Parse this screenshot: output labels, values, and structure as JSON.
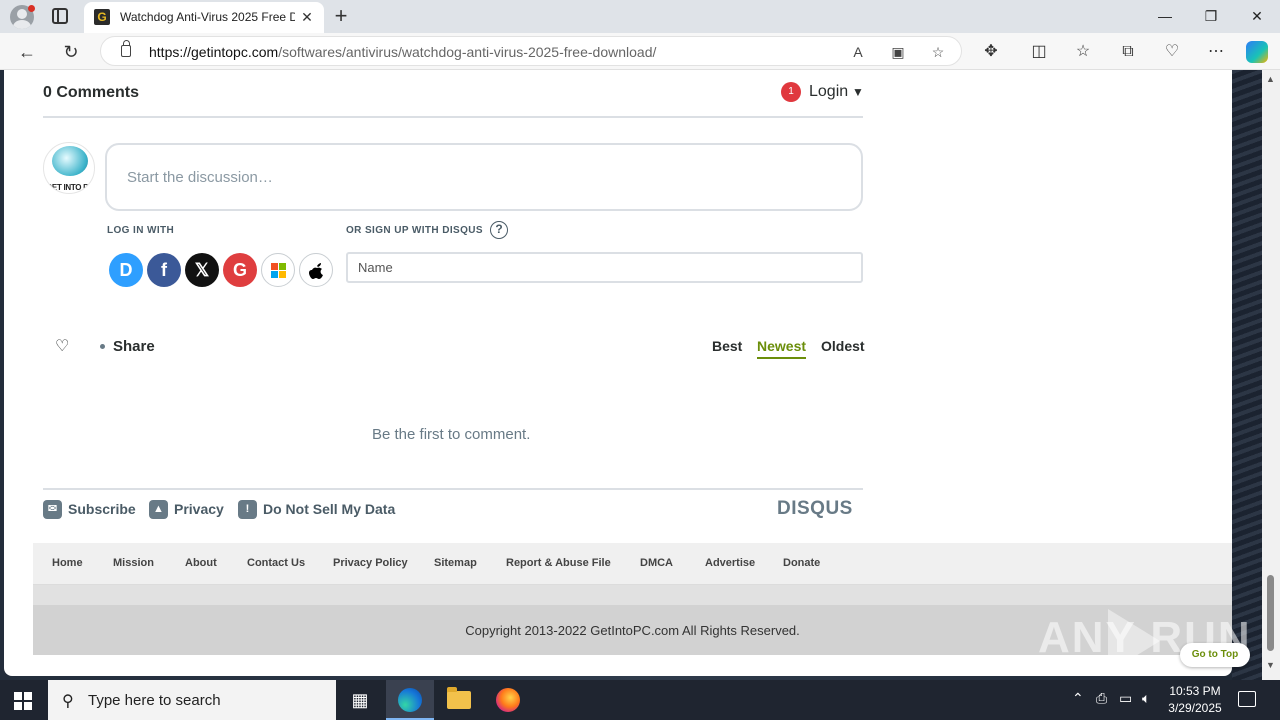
{
  "browser": {
    "tab_title": "Watchdog Anti-Virus 2025 Free D",
    "favicon_letter": "G",
    "url_domain": "https://getintopc.com",
    "url_path": "/softwares/antivirus/watchdog-anti-virus-2025-free-download/"
  },
  "disqus": {
    "comments_count": "0 Comments",
    "notification_count": "1",
    "login_label": "Login",
    "avatar_text": "GET INTO PC",
    "discussion_placeholder": "Start the discussion…",
    "log_in_with": "LOG IN WITH",
    "sign_up_with": "OR SIGN UP WITH DISQUS",
    "help_symbol": "?",
    "social": [
      "D",
      "f",
      "𝕏",
      "G",
      "",
      ""
    ],
    "name_placeholder": "Name",
    "share_label": "Share",
    "sort": {
      "best": "Best",
      "newest": "Newest",
      "oldest": "Oldest",
      "active": "Newest"
    },
    "empty_message": "Be the first to comment.",
    "footer": {
      "subscribe": "Subscribe",
      "privacy": "Privacy",
      "do_not_sell": "Do Not Sell My Data"
    },
    "logo": "DISQUS"
  },
  "site_footer": {
    "nav": [
      "Home",
      "Mission",
      "About",
      "Contact Us",
      "Privacy Policy",
      "Sitemap",
      "Report & Abuse File",
      "DMCA",
      "Advertise",
      "Donate"
    ],
    "copyright": "Copyright 2013-2022 GetIntoPC.com All Rights Reserved.",
    "go_to_top": "Go to Top"
  },
  "watermark": "ANY RUN",
  "taskbar": {
    "search_placeholder": "Type here to search",
    "time": "10:53 PM",
    "date": "3/29/2025"
  },
  "colors": {
    "accent_green": "#6b8e0a",
    "disqus_blue": "#2e9fff",
    "notification_red": "#e0383e"
  }
}
